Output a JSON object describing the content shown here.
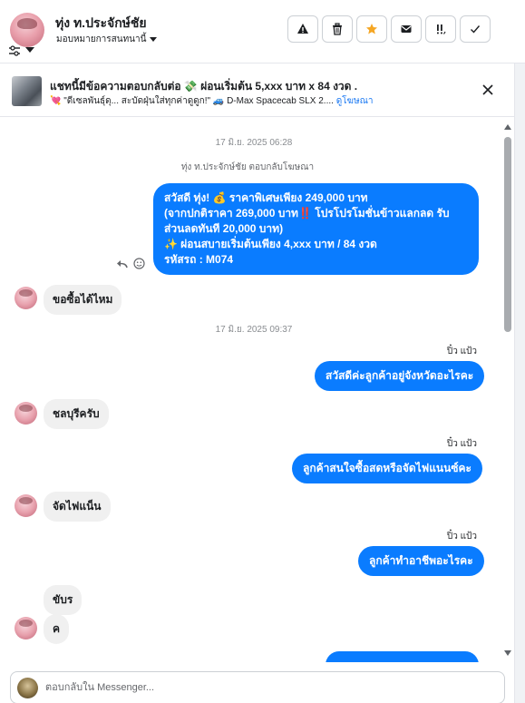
{
  "header": {
    "contact_name": "ทุ่ง ท.ประจักษ์ชัย",
    "assign_label": "มอบหมายการสนทนานี้",
    "actions": [
      "warning-icon",
      "trash-icon",
      "star-icon",
      "envelope-icon",
      "follow-up-icon",
      "check-icon"
    ],
    "star_color": "#f5a623"
  },
  "ad": {
    "title": "แชทนี้มีข้อความตอบกลับต่อ 💸 ผ่อนเริ่มต้น 5,xxx บาท x 84 งวด .",
    "subtitle": "💘 \"ดีเซลพันธุ์ดุ... สะบัดฝุ่นใส่ทุกค่าดูดูก!\" 🚙 D-Max Spacecab SLX 2....",
    "link": "ดูโฆษณา"
  },
  "messages": {
    "ts1": "17 มิ.ย. 2025 06:28",
    "ad_reply_note": "ทุ่ง ท.ประจักษ์ชัย ตอบกลับโฆษณา",
    "out1": [
      "สวัสดี ทุ่ง! 💰 ราคาพิเศษเพียง 249,000 บาท",
      "(จากปกติราคา 269,000 บาท‼️ โปรโปรโมชั่นข้าวแลกลด รับ",
      "ส่วนลดทันที 20,000 บาท)",
      "✨ ผ่อนสบายเริ่มต้นเพียง 4,xxx บาท / 84 งวด",
      "รหัสรถ : M074"
    ],
    "in1": "ขอซื้อได้ไหม",
    "ts2": "17 มิ.ย. 2025 09:37",
    "sender1": "ปิ๋ว แป้ว",
    "out2": "สวัสดีค่ะลูกค้าอยู่จังหวัดอะไรคะ",
    "in2": "ชลบุรีครับ",
    "sender2": "ปิ๋ว แป้ว",
    "out3": "ลูกค้าสนใจซื้อสดหรือจัดไฟแนนซ์คะ",
    "in3": "จัดไฟแน็น",
    "sender3": "ปิ๋ว แป้ว",
    "out4": "ลูกค้าทำอาชีพอะไรคะ",
    "in4": "ขับร",
    "in5": "ค"
  },
  "composer": {
    "placeholder": "ตอบกลับใน Messenger..."
  },
  "colors": {
    "outgoing_bubble": "#0a7cff",
    "incoming_bubble": "#f0f0f0"
  }
}
